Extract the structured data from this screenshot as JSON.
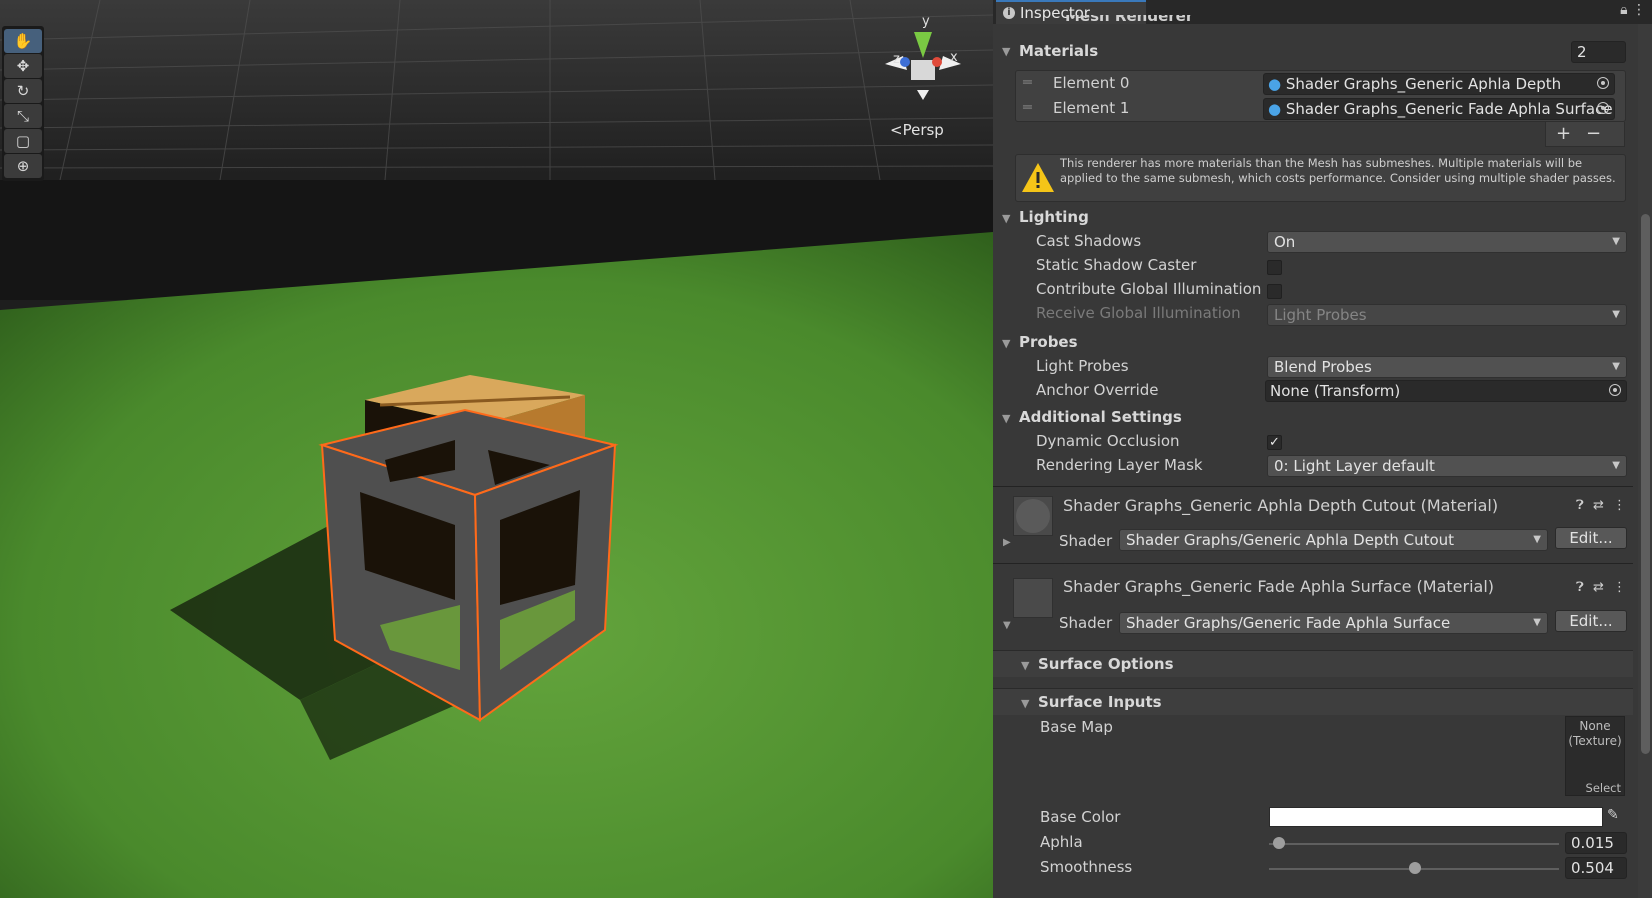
{
  "scene": {
    "view_label": "Persp",
    "gizmo": {
      "y": "y",
      "x": "x",
      "z": "z"
    },
    "tools": [
      "hand-icon",
      "move-icon",
      "rotate-icon",
      "scale-icon",
      "rect-icon",
      "transform-icon"
    ]
  },
  "inspector": {
    "tab_label": "Inspector",
    "component_title": "Mesh Renderer",
    "materials": {
      "header": "Materials",
      "count": "2",
      "elements": [
        {
          "label": "Element 0",
          "value": "Shader Graphs_Generic Aphla Depth Cutout"
        },
        {
          "label": "Element 1",
          "value": "Shader Graphs_Generic Fade Aphla Surface"
        }
      ],
      "add": "+",
      "remove": "−"
    },
    "warning": "This renderer has more materials than the Mesh has submeshes. Multiple materials will be applied to the same submesh, which costs performance. Consider using multiple shader passes.",
    "lighting": {
      "header": "Lighting",
      "cast_shadows_label": "Cast Shadows",
      "cast_shadows_value": "On",
      "static_shadow_label": "Static Shadow Caster",
      "static_shadow_checked": false,
      "contribute_gi_label": "Contribute Global Illumination",
      "contribute_gi_checked": false,
      "receive_gi_label": "Receive Global Illumination",
      "receive_gi_value": "Light Probes"
    },
    "probes": {
      "header": "Probes",
      "light_probes_label": "Light Probes",
      "light_probes_value": "Blend Probes",
      "anchor_label": "Anchor Override",
      "anchor_value": "None (Transform)"
    },
    "additional": {
      "header": "Additional Settings",
      "dynamic_occlusion_label": "Dynamic Occlusion",
      "dynamic_occlusion_checked": true,
      "check_mark": "✓",
      "layer_mask_label": "Rendering Layer Mask",
      "layer_mask_value": "0: Light Layer default"
    },
    "material1": {
      "title": "Shader Graphs_Generic Aphla Depth Cutout (Material)",
      "shader_label": "Shader",
      "shader_value": "Shader Graphs/Generic Aphla Depth Cutout",
      "edit": "Edit..."
    },
    "material2": {
      "title": "Shader Graphs_Generic Fade Aphla Surface (Material)",
      "shader_label": "Shader",
      "shader_value": "Shader Graphs/Generic Fade Aphla Surface",
      "edit": "Edit..."
    },
    "surface_options": "Surface Options",
    "surface_inputs": {
      "header": "Surface Inputs",
      "base_map_label": "Base Map",
      "texture_none": "None (Texture)",
      "texture_select": "Select",
      "base_color_label": "Base Color",
      "base_color": "#ffffff",
      "aphla_label": "Aphla",
      "aphla_value": "0.015",
      "aphla_fraction": 0.015,
      "smoothness_label": "Smoothness",
      "smoothness_value": "0.504",
      "smoothness_fraction": 0.504
    }
  }
}
